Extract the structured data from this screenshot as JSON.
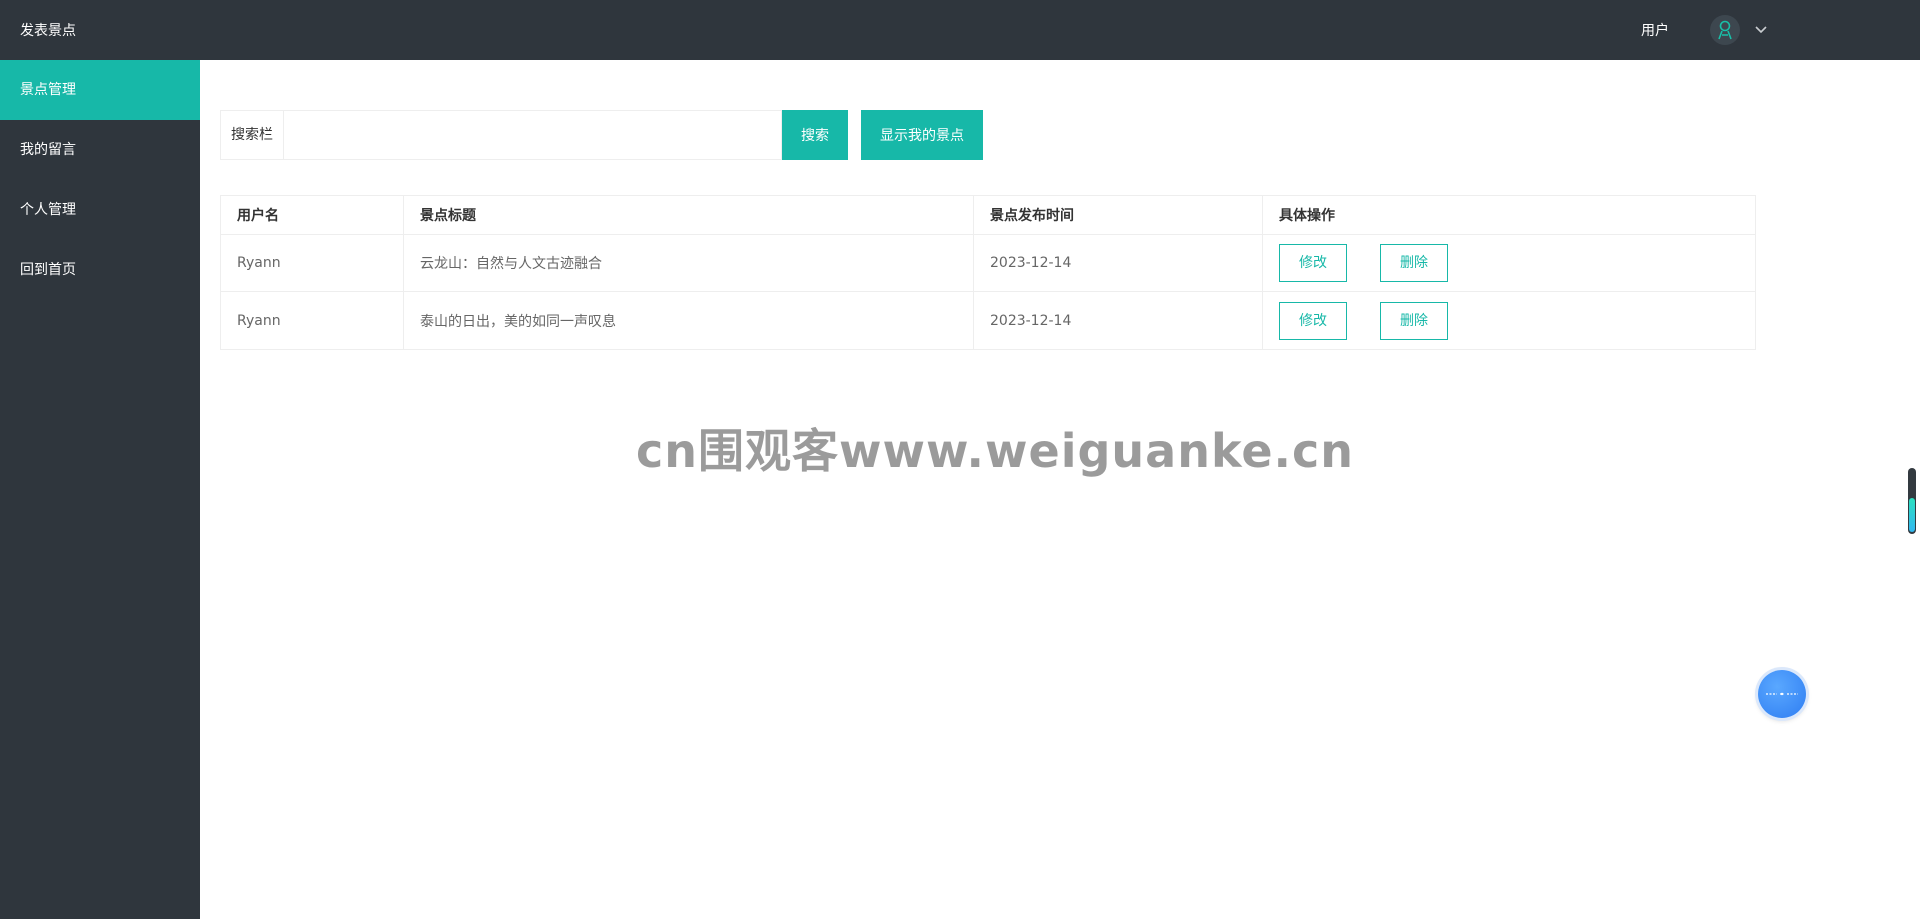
{
  "header": {
    "brand": "发表景点",
    "user_label": "用户"
  },
  "sidebar": {
    "items": [
      {
        "label": "景点管理",
        "active": true
      },
      {
        "label": "我的留言",
        "active": false
      },
      {
        "label": "个人管理",
        "active": false
      },
      {
        "label": "回到首页",
        "active": false
      }
    ]
  },
  "search": {
    "label": "搜索栏",
    "value": "",
    "placeholder": "",
    "search_button": "搜索",
    "mine_button": "显示我的景点"
  },
  "table": {
    "columns": [
      "用户名",
      "景点标题",
      "景点发布时间",
      "具体操作"
    ],
    "rows": [
      {
        "username": "Ryann",
        "title": "云龙山：自然与人文古迹融合",
        "date": "2023-12-14",
        "edit": "修改",
        "delete": "删除"
      },
      {
        "username": "Ryann",
        "title": "泰山的日出，美的如同一声叹息",
        "date": "2023-12-14",
        "edit": "修改",
        "delete": "删除"
      }
    ]
  },
  "watermark": "cn围观客www.weiguanke.cn",
  "colors": {
    "header_bg": "#2f363d",
    "accent": "#17b8a8",
    "float_button": "#2e7df2"
  },
  "icons": {
    "avatar": "avatar-icon",
    "caret": "chevron-down-icon",
    "float": "assistant-icon"
  }
}
